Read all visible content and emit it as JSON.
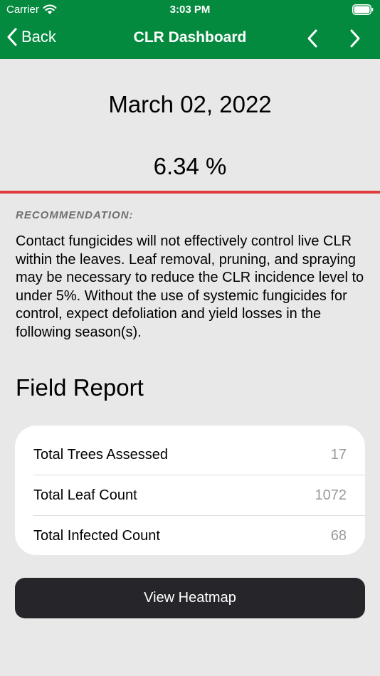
{
  "status_bar": {
    "carrier": "Carrier",
    "time": "3:03 PM",
    "icons": [
      "wifi-icon",
      "battery-icon"
    ]
  },
  "nav": {
    "back_label": "Back",
    "title": "CLR Dashboard",
    "icons": [
      "chevron-left-icon",
      "chevron-right-icon"
    ]
  },
  "summary": {
    "date": "March 02, 2022",
    "percentage": "6.34 %"
  },
  "recommendation": {
    "label": "RECOMMENDATION:",
    "text": "Contact fungicides will not effectively control live CLR within the leaves. Leaf removal, pruning, and spraying may be necessary to reduce the CLR incidence level to under 5%. Without the use of systemic fungicides for control, expect defoliation and yield losses in the following season(s)."
  },
  "field_report": {
    "heading": "Field Report",
    "rows": [
      {
        "label": "Total Trees Assessed",
        "value": "17"
      },
      {
        "label": "Total Leaf Count",
        "value": "1072"
      },
      {
        "label": "Total Infected Count",
        "value": "68"
      }
    ]
  },
  "actions": {
    "heatmap_label": "View Heatmap"
  },
  "colors": {
    "header": "#048a3f",
    "alert_line": "#e23a3a",
    "background": "#e8e8e8",
    "button": "#26262a"
  }
}
